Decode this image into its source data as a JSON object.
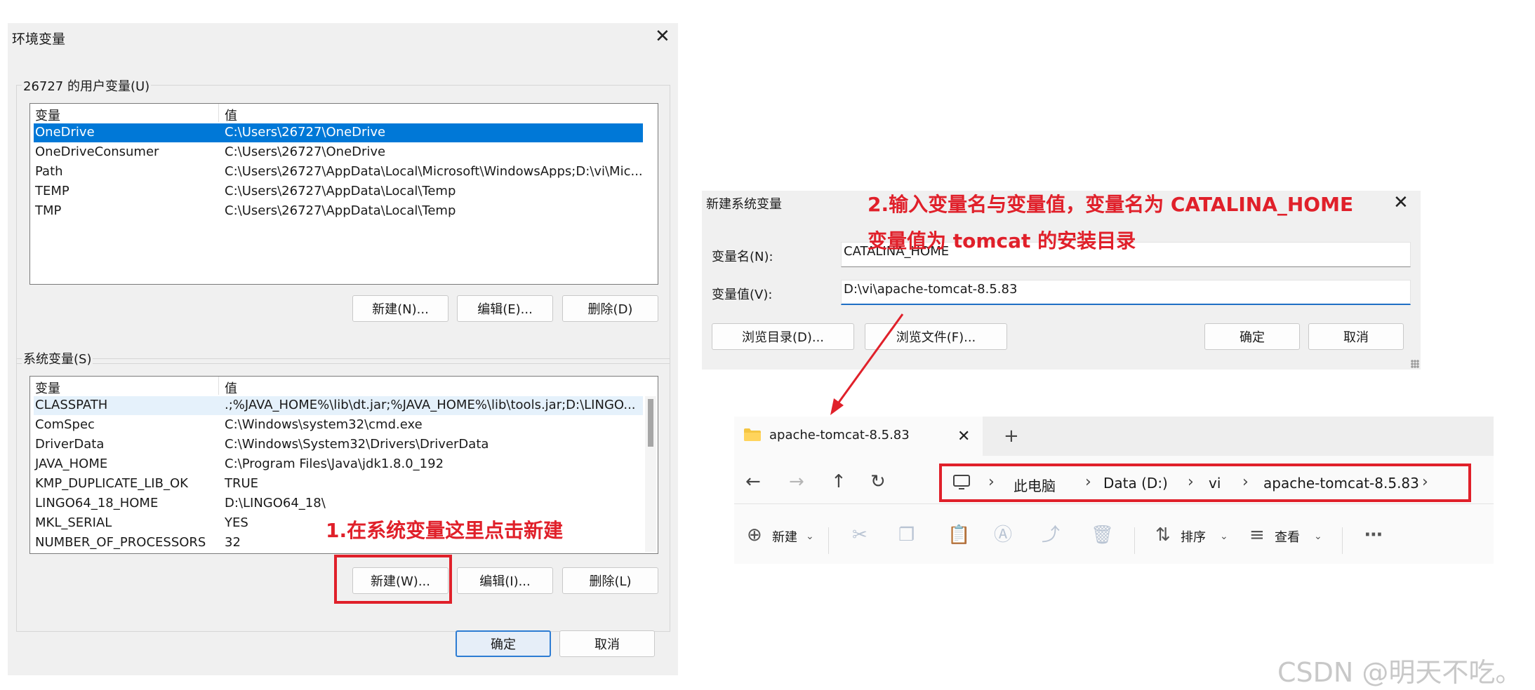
{
  "env_dialog": {
    "title": "环境变量",
    "user_group_label": "26727 的用户变量(U)",
    "system_group_label": "系统变量(S)",
    "col_variable": "变量",
    "col_value": "值",
    "user_vars": [
      {
        "name": "OneDrive",
        "value": "C:\\Users\\26727\\OneDrive"
      },
      {
        "name": "OneDriveConsumer",
        "value": "C:\\Users\\26727\\OneDrive"
      },
      {
        "name": "Path",
        "value": "C:\\Users\\26727\\AppData\\Local\\Microsoft\\WindowsApps;D:\\vi\\Mic..."
      },
      {
        "name": "TEMP",
        "value": "C:\\Users\\26727\\AppData\\Local\\Temp"
      },
      {
        "name": "TMP",
        "value": "C:\\Users\\26727\\AppData\\Local\\Temp"
      }
    ],
    "system_vars": [
      {
        "name": "CLASSPATH",
        "value": ".;%JAVA_HOME%\\lib\\dt.jar;%JAVA_HOME%\\lib\\tools.jar;D:\\LINGO..."
      },
      {
        "name": "ComSpec",
        "value": "C:\\Windows\\system32\\cmd.exe"
      },
      {
        "name": "DriverData",
        "value": "C:\\Windows\\System32\\Drivers\\DriverData"
      },
      {
        "name": "JAVA_HOME",
        "value": "C:\\Program Files\\Java\\jdk1.8.0_192"
      },
      {
        "name": "KMP_DUPLICATE_LIB_OK",
        "value": "TRUE"
      },
      {
        "name": "LINGO64_18_HOME",
        "value": "D:\\LINGO64_18\\"
      },
      {
        "name": "MKL_SERIAL",
        "value": "YES"
      },
      {
        "name": "NUMBER_OF_PROCESSORS",
        "value": "32"
      }
    ],
    "user_buttons": {
      "new": "新建(N)...",
      "edit": "编辑(E)...",
      "delete": "删除(D)"
    },
    "system_buttons": {
      "new": "新建(W)...",
      "edit": "编辑(I)...",
      "delete": "删除(L)"
    },
    "ok": "确定",
    "cancel": "取消"
  },
  "annotations": {
    "step1": "1.在系统变量这里点击新建",
    "step2_line1": "2.输入变量名与变量值，变量名为 CATALINA_HOME",
    "step2_line2": "变量值为 tomcat 的安装目录"
  },
  "new_var_dialog": {
    "title": "新建系统变量",
    "name_label": "变量名(N):",
    "name_value": "CATALINA_HOME",
    "value_label": "变量值(V):",
    "value_value": "D:\\vi\\apache-tomcat-8.5.83",
    "browse_dir": "浏览目录(D)...",
    "browse_file": "浏览文件(F)...",
    "ok": "确定",
    "cancel": "取消"
  },
  "explorer": {
    "tab_title": "apache-tomcat-8.5.83",
    "breadcrumbs": [
      "此电脑",
      "Data (D:)",
      "vi",
      "apache-tomcat-8.5.83"
    ],
    "cmd_new": "新建",
    "cmd_sort": "排序",
    "cmd_view": "查看"
  },
  "watermark": "CSDN @明天不吃。",
  "colors": {
    "accent": "#0078d7",
    "annotation_red": "#e0202a",
    "folder_yellow": "#f4c542"
  }
}
